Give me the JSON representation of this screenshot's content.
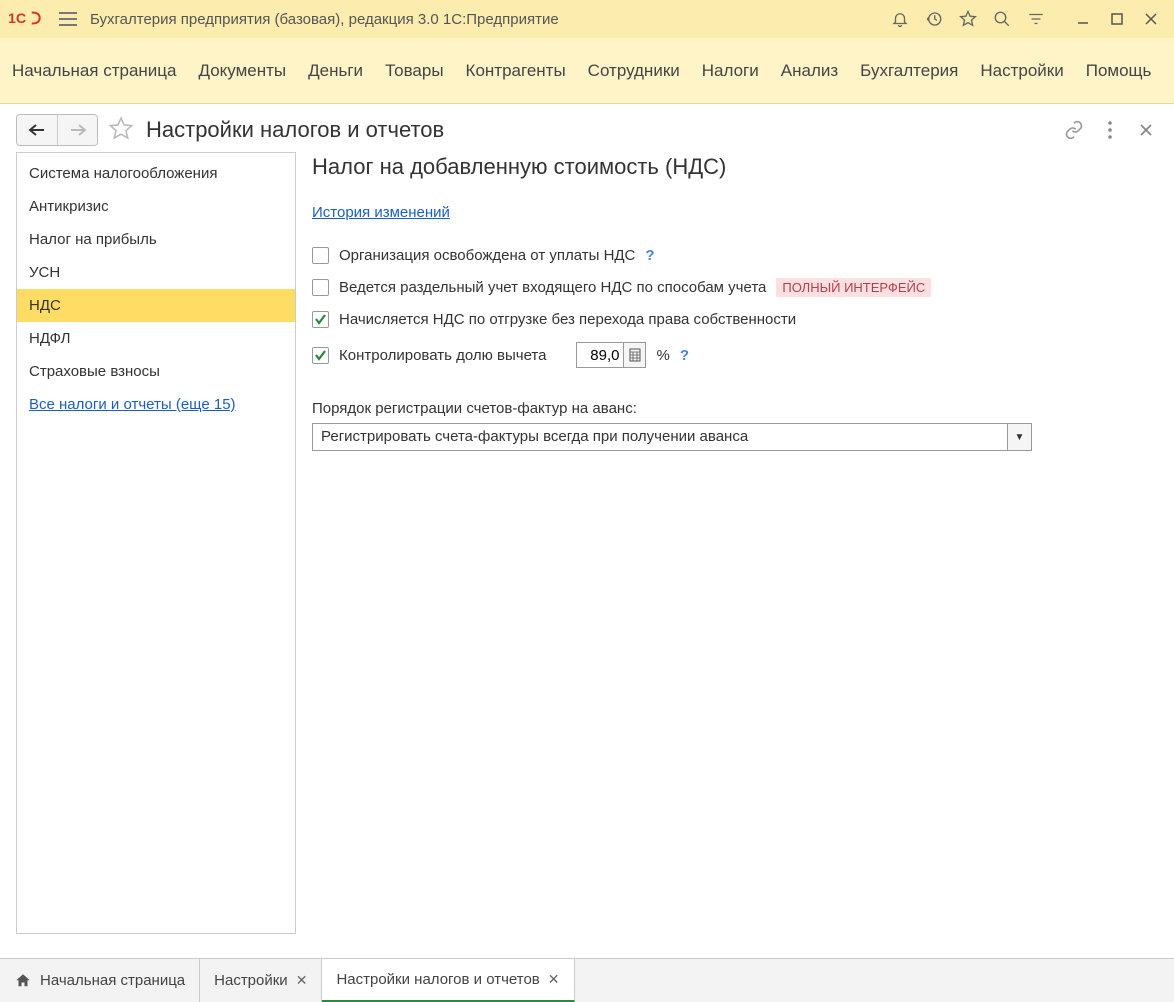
{
  "titlebar": {
    "title": "Бухгалтерия предприятия (базовая), редакция 3.0 1С:Предприятие"
  },
  "mainnav": {
    "items": [
      "Начальная страница",
      "Документы",
      "Деньги",
      "Товары",
      "Контрагенты",
      "Сотрудники",
      "Налоги",
      "Анализ",
      "Бухгалтерия",
      "Настройки",
      "Помощь"
    ]
  },
  "page": {
    "title": "Настройки налогов и отчетов"
  },
  "sidebar": {
    "items": [
      "Система налогообложения",
      "Антикризис",
      "Налог на прибыль",
      "УСН",
      "НДС",
      "НДФЛ",
      "Страховые взносы"
    ],
    "active_index": 4,
    "all_link": "Все налоги и отчеты (еще 15)"
  },
  "main": {
    "heading": "Налог на добавленную стоимость (НДС)",
    "history_link": "История изменений",
    "chk1_label": "Организация освобождена от уплаты НДС",
    "chk2_label": "Ведется раздельный учет входящего НДС по способам учета",
    "chk2_badge": "ПОЛНЫЙ ИНТЕРФЕЙС",
    "chk3_label": "Начисляется НДС по отгрузке без перехода права собственности",
    "chk4_label": "Контролировать долю вычета",
    "deduction_value": "89,0",
    "percent": "%",
    "help": "?",
    "select_label": "Порядок регистрации счетов-фактур на аванс:",
    "select_value": "Регистрировать счета-фактуры всегда при получении аванса"
  },
  "bottom_tabs": {
    "items": [
      {
        "label": "Начальная страница",
        "home": true,
        "closable": false,
        "active": false
      },
      {
        "label": "Настройки",
        "home": false,
        "closable": true,
        "active": false
      },
      {
        "label": "Настройки налогов и отчетов",
        "home": false,
        "closable": true,
        "active": true
      }
    ]
  }
}
